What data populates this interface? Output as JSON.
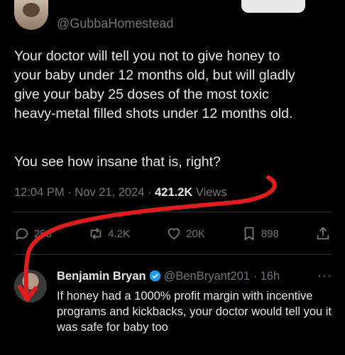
{
  "top": {
    "handle": "@GubbaHomestead"
  },
  "tweet": {
    "text": "Your doctor will tell you not to give honey to\nyour baby under 12 months old, but will gladly\ngive your baby 25 doses of the most toxic\nheavy-metal filled shots under 12 months old.",
    "question": "You see how insane that is, right?",
    "time": "12:04 PM · Nov 21, 2024 · ",
    "views_count": "421.2K",
    "views_label": " Views"
  },
  "actions": {
    "replies": "258",
    "reposts": "4.2K",
    "likes": "20K",
    "bookmarks": "898"
  },
  "reply": {
    "name": "Benjamin Bryan",
    "handle": "@BenBryant201 · 16h",
    "more": "···",
    "text": "If honey had a 1000% profit margin with incentive programs and kickbacks, your doctor would tell you it was safe for baby too"
  },
  "colors": {
    "background": "#000000",
    "text": "#e7e9ea",
    "muted": "#71767b",
    "verified": "#1d9bf0",
    "annotation": "#e01c1c"
  },
  "icons": [
    "reply-icon",
    "repost-icon",
    "like-icon",
    "bookmark-icon",
    "share-icon",
    "verified-badge-icon",
    "more-icon"
  ]
}
